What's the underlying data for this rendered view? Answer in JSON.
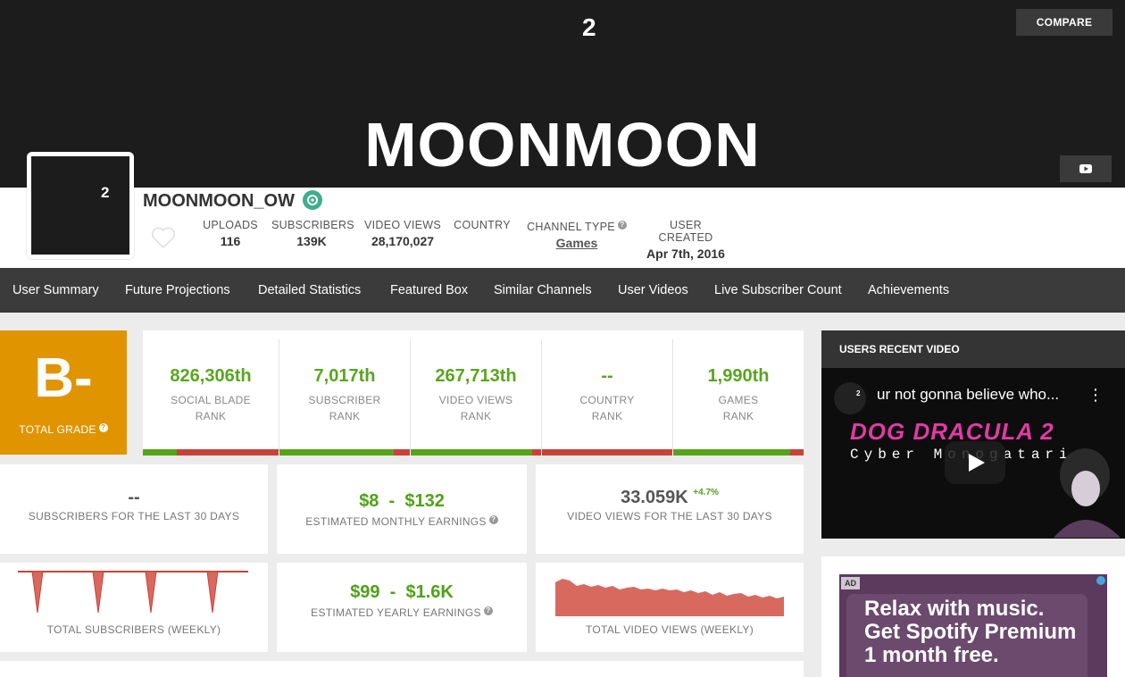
{
  "banner": {
    "title": "MOONMOON",
    "compare_label": "COMPARE",
    "logo_superscript": "2"
  },
  "profile": {
    "channel_name": "MOONMOON_OW",
    "avatar_superscript": "2",
    "stats": [
      {
        "label": "UPLOADS",
        "value": "116"
      },
      {
        "label": "SUBSCRIBERS",
        "value": "139K"
      },
      {
        "label": "VIDEO VIEWS",
        "value": "28,170,027"
      },
      {
        "label": "COUNTRY",
        "value": ""
      },
      {
        "label": "CHANNEL TYPE",
        "value": "Games"
      },
      {
        "label": "USER CREATED",
        "value": "Apr 7th, 2016"
      }
    ]
  },
  "nav": {
    "items": [
      "User Summary",
      "Future Projections",
      "Detailed Statistics",
      "Featured Box",
      "Similar Channels",
      "User Videos",
      "Live Subscriber Count",
      "Achievements"
    ]
  },
  "grade": {
    "letter": "B-",
    "label": "TOTAL GRADE"
  },
  "ranks": [
    {
      "value": "826,306th",
      "line1": "SOCIAL BLADE",
      "line2": "RANK",
      "fill": 0.25
    },
    {
      "value": "7,017th",
      "line1": "SUBSCRIBER",
      "line2": "RANK",
      "fill": 0.88
    },
    {
      "value": "267,713th",
      "line1": "VIDEO VIEWS",
      "line2": "RANK",
      "fill": 0.93
    },
    {
      "value": "--",
      "line1": "COUNTRY",
      "line2": "RANK",
      "fill": 0.0
    },
    {
      "value": "1,990th",
      "line1": "GAMES",
      "line2": "RANK",
      "fill": 0.9
    }
  ],
  "cards": {
    "subs30": {
      "value": "--",
      "label": "SUBSCRIBERS FOR THE LAST 30 DAYS"
    },
    "monthly": {
      "value": "$8  -  $132",
      "label": "ESTIMATED MONTHLY EARNINGS"
    },
    "views30": {
      "value": "33.059K",
      "change": "+4.7%",
      "label": "VIDEO VIEWS FOR THE LAST 30 DAYS"
    },
    "total_subs": {
      "label": "TOTAL SUBSCRIBERS (WEEKLY)"
    },
    "yearly": {
      "value": "$99  -  $1.6K",
      "label": "ESTIMATED YEARLY EARNINGS"
    },
    "total_views": {
      "label": "TOTAL VIDEO VIEWS (WEEKLY)"
    }
  },
  "video": {
    "header": "USERS RECENT VIDEO",
    "title": "ur not gonna believe who...",
    "menu_glyph": "⋮",
    "game_title": "DOG DRACULA 2",
    "game_subtitle": "Cyber Monogatari"
  },
  "ad": {
    "tag": "AD",
    "line1": "Relax with music.",
    "line2": "Get Spotify Premium",
    "line3": "1 month free."
  },
  "colors": {
    "grade_bg": "#e09400",
    "green": "#58a61e",
    "red": "#c9423a",
    "nav_bg": "#3b3b3b",
    "banner_bg": "#1c1c1c"
  }
}
